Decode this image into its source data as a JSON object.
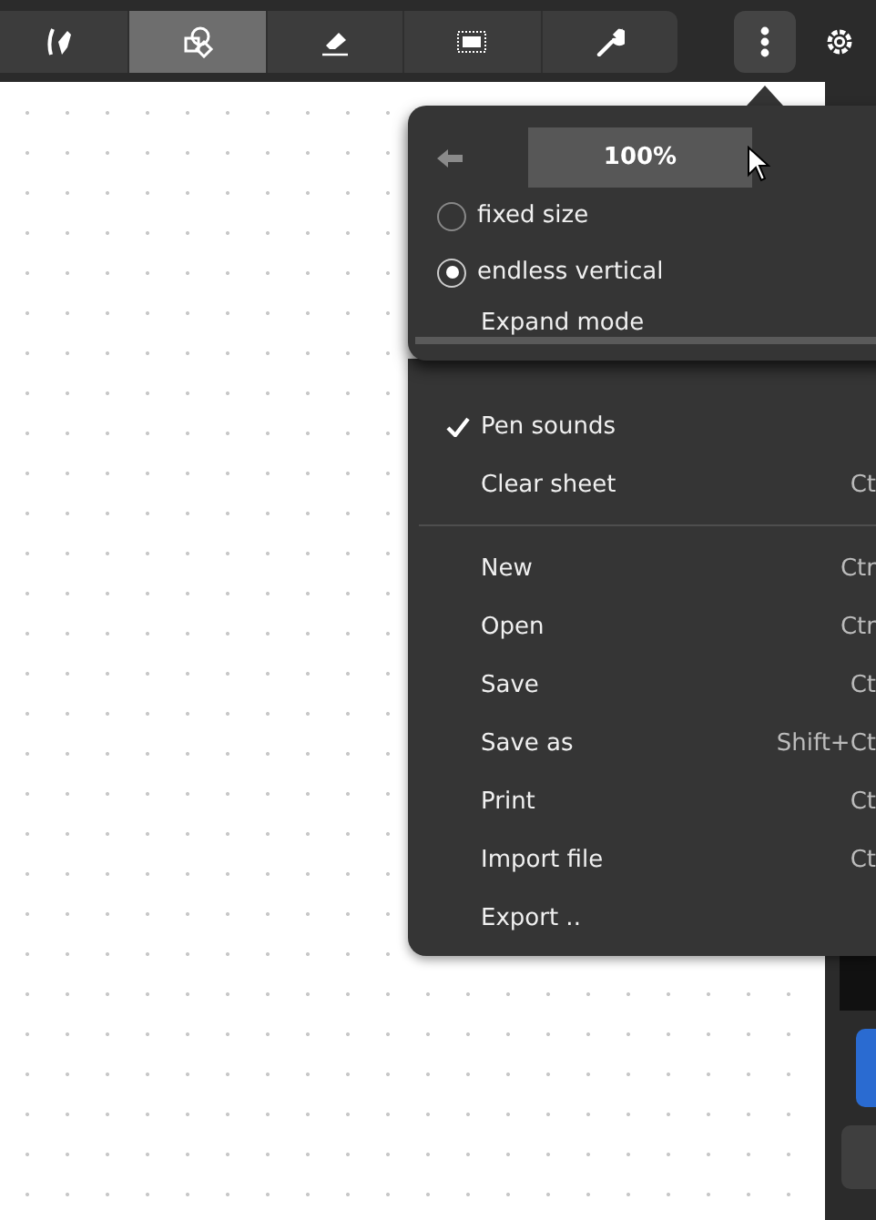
{
  "toolbar": {
    "tools": [
      {
        "kind": "pen",
        "selected": false
      },
      {
        "kind": "shapes",
        "selected": true
      },
      {
        "kind": "eraser",
        "selected": false
      },
      {
        "kind": "selection",
        "selected": false
      },
      {
        "kind": "wrench",
        "selected": false
      }
    ]
  },
  "zoom_popover": {
    "zoom_value": "100%",
    "options": [
      {
        "label": "fixed size",
        "selected": false
      },
      {
        "label": "endless vertical",
        "selected": true
      }
    ],
    "expand_label": "Expand mode"
  },
  "menu": {
    "sections": [
      [
        {
          "label": "Pen sounds",
          "checked": true
        },
        {
          "label": "Clear sheet",
          "checked": false,
          "shortcut": "Ct"
        }
      ],
      [
        {
          "label": "New",
          "checked": false,
          "shortcut": "Ctr"
        },
        {
          "label": "Open",
          "checked": false,
          "shortcut": "Ctr"
        },
        {
          "label": "Save",
          "checked": false,
          "shortcut": "Ct"
        },
        {
          "label": "Save as",
          "checked": false,
          "shortcut": "Shift+Ct"
        },
        {
          "label": "Print",
          "checked": false,
          "shortcut": "Ct"
        },
        {
          "label": "Import file",
          "checked": false,
          "shortcut": "Ct"
        },
        {
          "label": "Export ..",
          "checked": false
        }
      ]
    ]
  }
}
